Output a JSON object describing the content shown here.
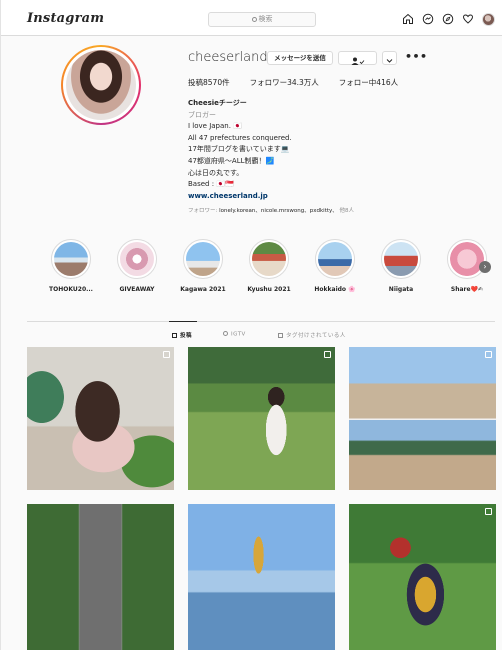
{
  "header": {
    "logo_text": "Instagram",
    "search_placeholder": "検索",
    "icons": [
      "home-icon",
      "messenger-icon",
      "explore-icon",
      "heart-icon",
      "profile-avatar"
    ]
  },
  "profile": {
    "username": "cheeserland",
    "message_button": "メッセージを送信",
    "follow_icon": "person-check-icon",
    "dropdown_icon": "chevron-down-icon",
    "more_label": "•••",
    "stats": {
      "posts": "投稿8570件",
      "followers": "フォロワー34.3万人",
      "following": "フォロー中416人"
    },
    "bio": {
      "name": "Cheesieチージー",
      "category": "ブロガー",
      "lines": [
        "I love Japan. 🇯🇵",
        "All 47 prefectures conquered.",
        "17年間ブログを書いています💻",
        "47都道府県〜ALL制覇！🗾",
        "心は日の丸です。",
        "Based : 🇯🇵🇸🇬"
      ],
      "website": "www.cheeserland.jp"
    },
    "followed_by": {
      "prefix": "フォロワー:",
      "names": "lonely.korean、nicole.mrswong、pxdkitty、",
      "suffix": "他8人"
    }
  },
  "highlights": [
    {
      "label": "TOHOKU20..."
    },
    {
      "label": "GIVEAWAY"
    },
    {
      "label": "Kagawa 2021"
    },
    {
      "label": "Kyushu 2021"
    },
    {
      "label": "Hokkaido 🌸"
    },
    {
      "label": "Niigata"
    },
    {
      "label": "Share❤️✍"
    }
  ],
  "tabs": [
    {
      "label": "投稿",
      "active": true
    },
    {
      "label": "IGTV",
      "active": false
    },
    {
      "label": "タグ付けされている人",
      "active": false
    }
  ],
  "colors": {
    "link": "#00376b",
    "secondary_text": "#8e8e8e",
    "border": "#dbdbdb",
    "ring_gradient": [
      "#f9a825",
      "#e1306c",
      "#c13584"
    ]
  }
}
